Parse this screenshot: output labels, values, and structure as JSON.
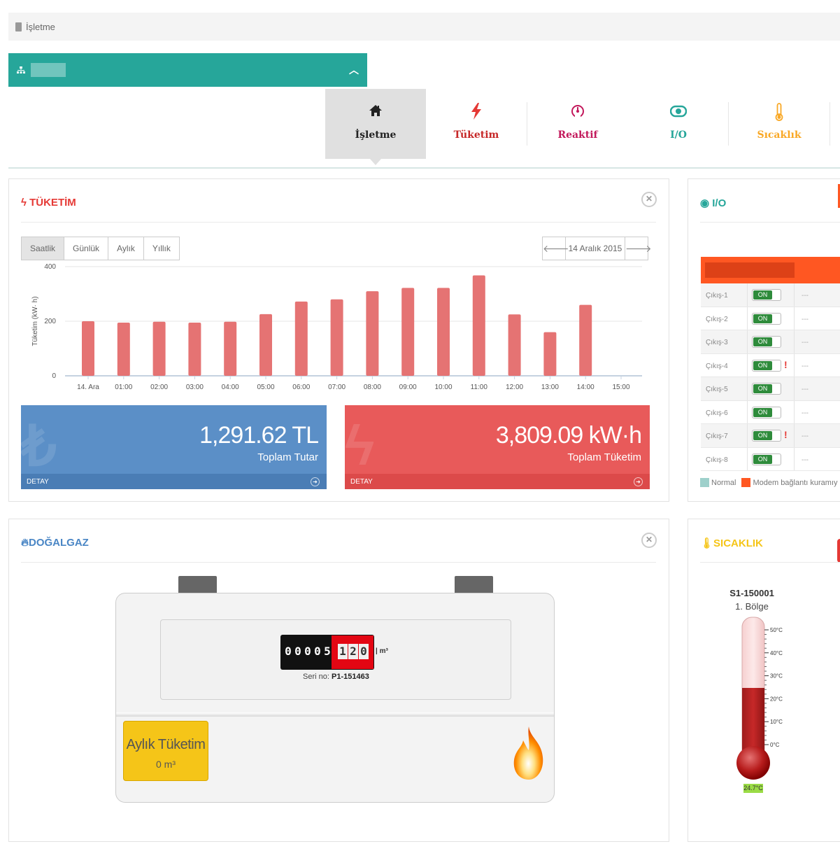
{
  "breadcrumb": {
    "label": "İşletme"
  },
  "nav": {
    "tabs": [
      {
        "label": "İşletme",
        "color": "#222222",
        "icon": "home-icon"
      },
      {
        "label": "Tüketim",
        "color": "#c62828",
        "icon": "lightning-icon"
      },
      {
        "label": "Reaktif",
        "color": "#c2185b",
        "icon": "gauge-icon"
      },
      {
        "label": "I/O",
        "color": "#26a69a",
        "icon": "toggle-icon"
      },
      {
        "label": "Sıcaklık",
        "color": "#f9a825",
        "icon": "thermometer-icon"
      }
    ]
  },
  "consumption": {
    "title": "TÜKETİM",
    "periods": [
      "Saatlik",
      "Günlük",
      "Aylık",
      "Yıllık"
    ],
    "selected_period": "Saatlik",
    "date": "14 Aralık 2015",
    "total_cost": {
      "value": "1,291.62 TL",
      "label": "Toplam Tutar",
      "footer": "DETAY"
    },
    "total_energy": {
      "value": "3,809.09 kW·h",
      "label": "Toplam Tüketim",
      "footer": "DETAY"
    }
  },
  "chart_data": {
    "type": "bar",
    "ylabel": "Tüketim (kW· h)",
    "ylim": [
      0,
      400
    ],
    "yticks": [
      0,
      200,
      400
    ],
    "categories": [
      "14. Ara",
      "01:00",
      "02:00",
      "03:00",
      "04:00",
      "05:00",
      "06:00",
      "07:00",
      "08:00",
      "09:00",
      "10:00",
      "11:00",
      "12:00",
      "13:00",
      "14:00",
      "15:00"
    ],
    "values": [
      200,
      195,
      198,
      195,
      198,
      226,
      272,
      280,
      310,
      322,
      322,
      368,
      225,
      160,
      260,
      null
    ],
    "color": "#e57373",
    "grid": true
  },
  "io": {
    "title": "I/O",
    "rows": [
      {
        "name": "Çıkış-1",
        "state": "ON",
        "warning": false,
        "value": "---"
      },
      {
        "name": "Çıkış-2",
        "state": "ON",
        "warning": false,
        "value": "---"
      },
      {
        "name": "Çıkış-3",
        "state": "ON",
        "warning": false,
        "value": "---"
      },
      {
        "name": "Çıkış-4",
        "state": "ON",
        "warning": true,
        "value": "---"
      },
      {
        "name": "Çıkış-5",
        "state": "ON",
        "warning": false,
        "value": "---"
      },
      {
        "name": "Çıkış-6",
        "state": "ON",
        "warning": false,
        "value": "---"
      },
      {
        "name": "Çıkış-7",
        "state": "ON",
        "warning": true,
        "value": "---"
      },
      {
        "name": "Çıkış-8",
        "state": "ON",
        "warning": false,
        "value": "---"
      }
    ],
    "legend": [
      {
        "label": "Normal",
        "color": "#9ed0cb"
      },
      {
        "label": "Modem bağlantı kuramıy",
        "color": "#ff5722"
      }
    ]
  },
  "gas": {
    "title": "DOĞALGAZ",
    "digits_white": [
      "0",
      "0",
      "0",
      "0",
      "5"
    ],
    "digits_red": [
      "1",
      "2",
      "0"
    ],
    "unit": "m³",
    "serial_label": "Seri no:",
    "serial_value": "P1-151463",
    "monthly_label": "Aylık Tüketim",
    "monthly_value": "0 m³"
  },
  "temperature": {
    "title": "SICAKLIK",
    "sensor": "S1-150001",
    "zone": "1. Bölge",
    "scale": [
      "50°C",
      "40°C",
      "30°C",
      "20°C",
      "10°C",
      "0°C"
    ],
    "reading": "24.7°C",
    "value": 24.7
  }
}
